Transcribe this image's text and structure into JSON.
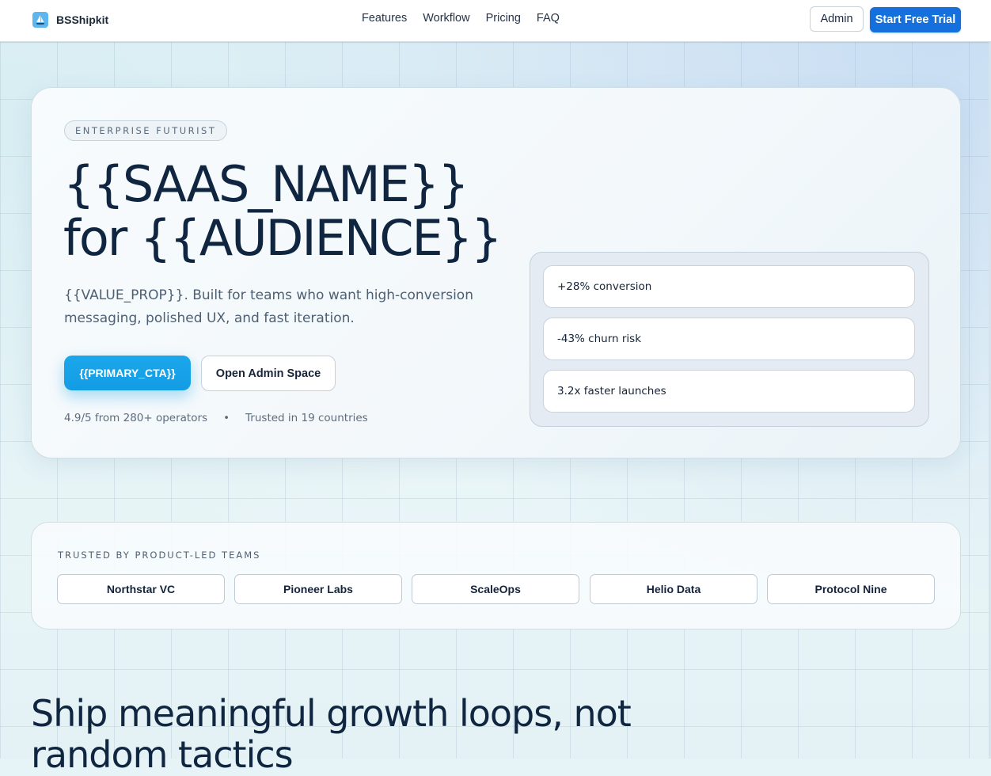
{
  "header": {
    "brand": "BSShipkit",
    "nav": [
      "Features",
      "Workflow",
      "Pricing",
      "FAQ"
    ],
    "admin_label": "Admin",
    "trial_label": "Start Free Trial"
  },
  "hero": {
    "eyebrow": "ENTERPRISE FUTURIST",
    "title_line1": "{{SAAS_NAME}}",
    "title_line2": "for {{AUDIENCE}}",
    "subtitle": "{{VALUE_PROP}}. Built for teams who want high-conversion messaging, polished UX, and fast iteration.",
    "primary_cta": "{{PRIMARY_CTA}}",
    "secondary_cta": "Open Admin Space",
    "rating": "4.9/5 from 280+ operators",
    "separator": "•",
    "trusted_countries": "Trusted in 19 countries",
    "metrics": [
      "+28% conversion",
      "-43% churn risk",
      "3.2x faster launches"
    ]
  },
  "logos": {
    "label": "TRUSTED BY PRODUCT-LED TEAMS",
    "items": [
      "Northstar VC",
      "Pioneer Labs",
      "ScaleOps",
      "Helio Data",
      "Protocol Nine"
    ]
  },
  "section": {
    "title": "Ship meaningful growth loops, not random tactics"
  },
  "colors": {
    "accent": "#1570de",
    "primary_cta": "#1ba7ec",
    "text_dark": "#0f2540"
  },
  "icons": {
    "brand": "sailboat-icon"
  }
}
